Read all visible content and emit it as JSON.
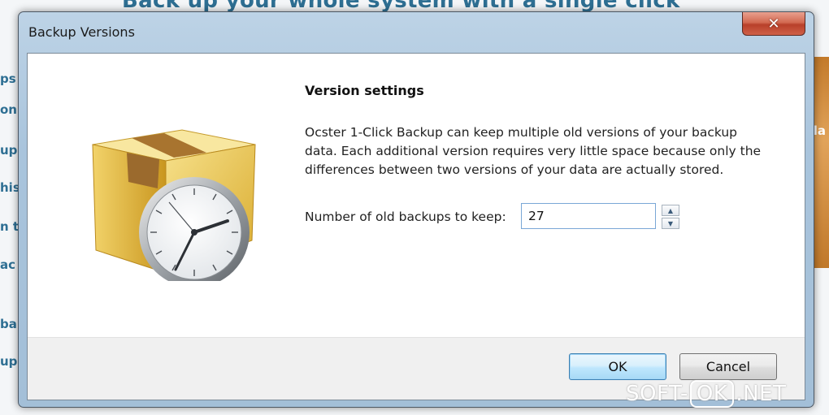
{
  "background": {
    "header": "Back up your whole system with a single click",
    "left_fragments": [
      "ps",
      "on t",
      "up",
      "his",
      "n t",
      "ac",
      "ba",
      "up"
    ],
    "right_fragment": "la"
  },
  "window": {
    "title": "Backup Versions",
    "close_glyph": "✕"
  },
  "content": {
    "section_title": "Version settings",
    "description": "Ocster 1-Click Backup can keep multiple old versions of your backup\ndata. Each additional version requires very little space because only the\ndifferences between two versions of your data are actually stored.",
    "field_label": "Number of old backups to keep:",
    "field_value": "27",
    "spin_up": "▲",
    "spin_down": "▼"
  },
  "buttons": {
    "ok": "OK",
    "cancel": "Cancel"
  },
  "watermark": {
    "left": "SOFT-",
    "boxed": "OK",
    "right": ".NET"
  },
  "colors": {
    "accent": "#3c7fb1",
    "link_blue": "#2e6f93",
    "box_yellow": "#e8c655",
    "tape_brown": "#9b6a2d"
  },
  "icons": {
    "illustration": "box-with-clock-icon"
  }
}
